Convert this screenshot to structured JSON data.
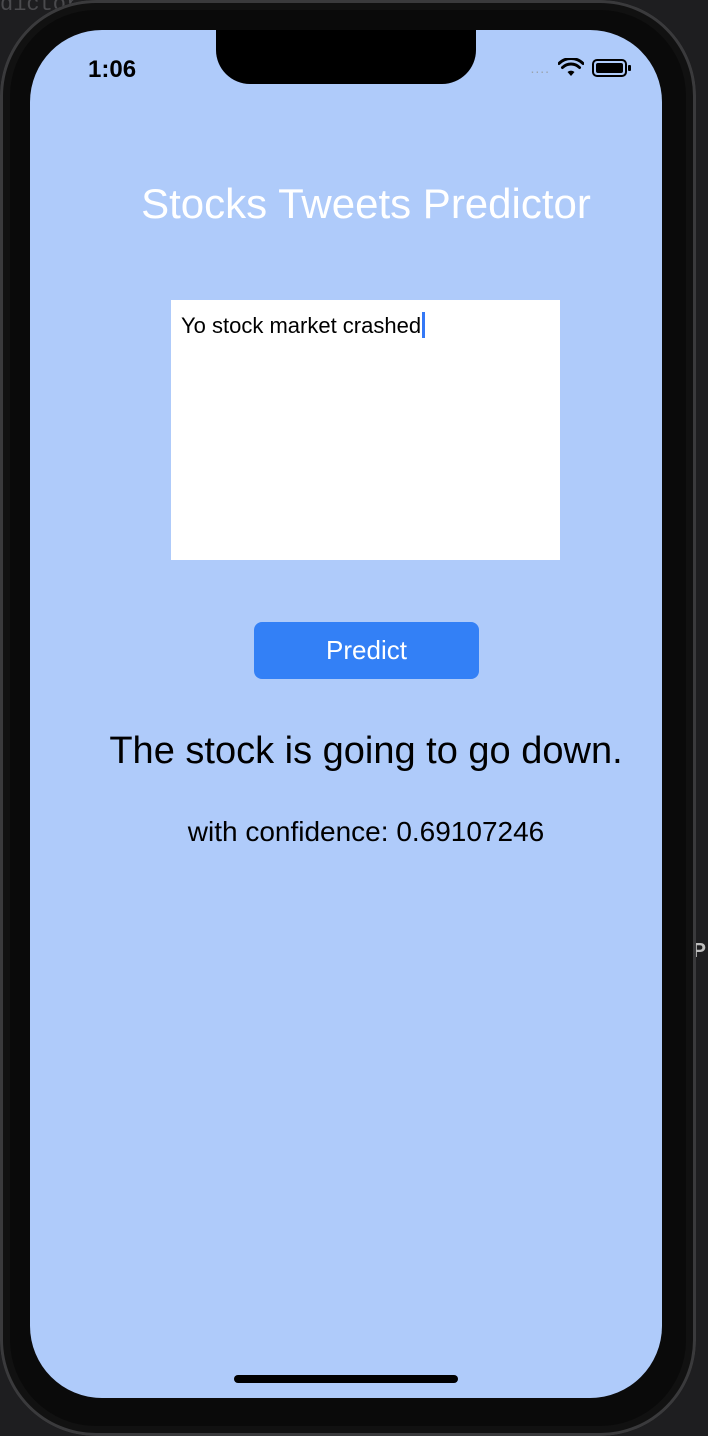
{
  "background": {
    "editor_fragment": "dictor",
    "side_letter": "P"
  },
  "status_bar": {
    "time": "1:06",
    "signal": "....",
    "wifi_icon": "wifi-icon",
    "battery_icon": "battery-icon"
  },
  "app": {
    "title": "Stocks Tweets Predictor",
    "tweet_input_value": "Yo stock market crashed",
    "predict_button_label": "Predict",
    "result_text": "The stock is going to go down.",
    "confidence_text": "with confidence: 0.69107246"
  },
  "colors": {
    "screen_background": "#afcbfa",
    "button_background": "#3380f6",
    "title_color": "#ffffff",
    "cursor_color": "#3478f6"
  }
}
